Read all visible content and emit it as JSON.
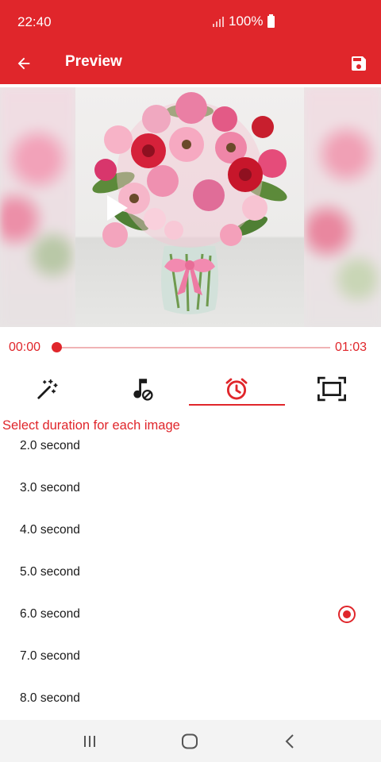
{
  "status_bar": {
    "time": "22:40",
    "battery": "100%"
  },
  "app_bar": {
    "title": "Preview",
    "back_icon": "arrow-left-icon",
    "save_icon": "save-floppy-icon"
  },
  "player": {
    "current_time": "00:00",
    "total_time": "01:03",
    "progress": 0,
    "play_icon": "play-icon"
  },
  "tabs": [
    {
      "icon": "magic-wand-icon",
      "selected": false
    },
    {
      "icon": "music-off-icon",
      "selected": false
    },
    {
      "icon": "alarm-clock-icon",
      "selected": true
    },
    {
      "icon": "aspect-ratio-icon",
      "selected": false
    }
  ],
  "duration_section": {
    "label": "Select duration for each image",
    "options": [
      {
        "label": "2.0 second",
        "selected": false
      },
      {
        "label": "3.0 second",
        "selected": false
      },
      {
        "label": "4.0 second",
        "selected": false
      },
      {
        "label": "5.0 second",
        "selected": false
      },
      {
        "label": "6.0 second",
        "selected": true
      },
      {
        "label": "7.0 second",
        "selected": false
      },
      {
        "label": "8.0 second",
        "selected": false
      }
    ]
  },
  "nav_bar": {
    "recents_icon": "recents-icon",
    "home_icon": "home-icon",
    "back_icon": "back-chevron-icon"
  },
  "colors": {
    "accent": "#e0262b"
  }
}
